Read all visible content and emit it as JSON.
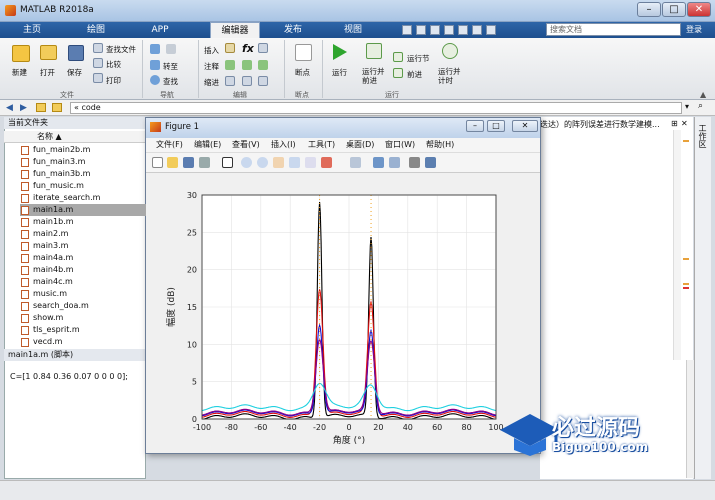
{
  "window": {
    "title": "MATLAB R2018a"
  },
  "tabs": [
    {
      "label": "主页"
    },
    {
      "label": "绘图"
    },
    {
      "label": "APP"
    },
    {
      "label": "编辑器"
    },
    {
      "label": "发布"
    },
    {
      "label": "视图"
    }
  ],
  "search": {
    "placeholder": "搜索文档",
    "login": "登录"
  },
  "ribbon": {
    "file": {
      "new": "新建",
      "open": "打开",
      "save": "保存",
      "find_files": "查找文件",
      "compare": "比较",
      "print": "打印",
      "group": "文件"
    },
    "nav": {
      "goto": "转至",
      "find": "查找",
      "group": "导航"
    },
    "edit": {
      "insert": "插入",
      "comment": "注释",
      "indent": "缩进",
      "fx": "fx",
      "group": "编辑"
    },
    "breakpoints": {
      "label": "断点",
      "group": "断点"
    },
    "run": {
      "run": "运行",
      "run_advance": "运行并\n前进",
      "run_section": "运行节",
      "advance": "前进",
      "run_time": "运行并\n计时",
      "group": "运行"
    }
  },
  "address": {
    "path": "« code"
  },
  "current_folder": {
    "title": "当前文件夹",
    "column": "名称 ▲",
    "files": [
      "fun_main2b.m",
      "fun_main3.m",
      "fun_main3b.m",
      "fun_music.m",
      "iterate_search.m",
      "main1a.m",
      "main1b.m",
      "main2.m",
      "main3.m",
      "main4a.m",
      "main4b.m",
      "main4c.m",
      "music.m",
      "search_doa.m",
      "show.m",
      "tls_esprit.m",
      "vecd.m"
    ],
    "selected_index": 5
  },
  "details": {
    "title": "main1a.m  (脚本)",
    "content": "C=[1 0.84 0.36 0.07 0 0 0 0];"
  },
  "editor": {
    "text": "迭达）的阵列误差进行数学建模..."
  },
  "right_strip": {
    "label": "工作区"
  },
  "figure": {
    "title": "Figure 1",
    "menus": [
      "文件(F)",
      "编辑(E)",
      "查看(V)",
      "插入(I)",
      "工具(T)",
      "桌面(D)",
      "窗口(W)",
      "帮助(H)"
    ]
  },
  "watermark": {
    "line1": "必过源码",
    "line2": "Biguo100.com"
  },
  "chart_data": {
    "type": "line",
    "xlabel": "角度 (°)",
    "ylabel": "幅度 (dB)",
    "xlim": [
      -100,
      100
    ],
    "ylim": [
      0,
      30
    ],
    "xticks": [
      -100,
      -80,
      -60,
      -40,
      -20,
      0,
      20,
      40,
      60,
      80,
      100
    ],
    "yticks": [
      0,
      5,
      10,
      15,
      20,
      25,
      30
    ],
    "grid": true,
    "source_angles": [
      -20,
      15
    ],
    "series": [
      {
        "color": "#000000",
        "peaks": [
          29,
          24
        ],
        "width": 2.2,
        "floor": 0.3
      },
      {
        "color": "#e01010",
        "peaks": [
          17,
          15
        ],
        "width": 3.2,
        "floor": 0.6
      },
      {
        "color": "#1010d0",
        "peaks": [
          12,
          11
        ],
        "width": 3.0,
        "floor": 0.8
      },
      {
        "color": "#8b008b",
        "peaks": [
          10,
          9.5
        ],
        "width": 3.5,
        "floor": 0.9
      },
      {
        "color": "#20d0e0",
        "peaks": [
          3.5,
          3
        ],
        "width": 6,
        "floor": 1.5
      }
    ]
  }
}
